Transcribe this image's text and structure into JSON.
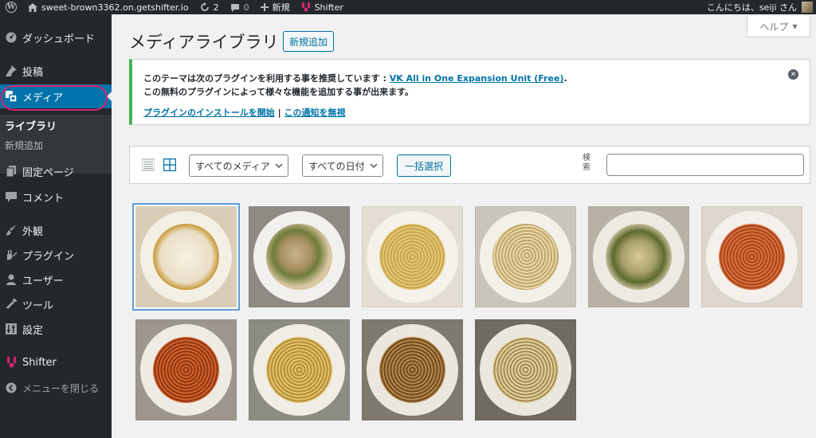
{
  "adminbar": {
    "site_name": "sweet-brown3362.on.getshifter.io",
    "updates_count": "2",
    "comments_count": "0",
    "new_label": "新規",
    "shifter_label": "Shifter",
    "greeting": "こんにちは、seiji さん"
  },
  "sidebar": {
    "dashboard": "ダッシュボード",
    "posts": "投稿",
    "media": "メディア",
    "library": "ライブラリ",
    "add_new": "新規追加",
    "pages": "固定ページ",
    "comments": "コメント",
    "appearance": "外観",
    "plugins": "プラグイン",
    "users": "ユーザー",
    "tools": "ツール",
    "settings": "設定",
    "shifter": "Shifter",
    "collapse": "メニューを閉じる"
  },
  "page": {
    "title": "メディアライブラリ",
    "add_new_button": "新規追加",
    "help_tab": "ヘルプ"
  },
  "notice": {
    "text_before_link": "このテーマは次のプラグインを利用する事を推奨しています : ",
    "plugin_link": "VK All in One Expansion Unit (Free)",
    "text_after_link": ".",
    "line2": "この無料のプラグインによって様々な機能を追加する事が出来ます。",
    "install_link": "プラグインのインストールを開始",
    "separator": " | ",
    "dismiss_link": "この通知を無視"
  },
  "toolbar": {
    "filter_type": "すべてのメディア",
    "filter_date": "すべての日付",
    "bulk_select": "一括選択",
    "search_label": "検索"
  },
  "colors": {
    "admin_dark": "#23282d",
    "accent_blue": "#0073aa",
    "notice_green": "#46b450",
    "highlight_pink": "#d4246c"
  },
  "media_items": [
    {
      "subject": "cream soup dish",
      "selected": true
    },
    {
      "subject": "rigatoni pasta"
    },
    {
      "subject": "plain spaghetti"
    },
    {
      "subject": "tagliatelle with cheese"
    },
    {
      "subject": "rigatoni with herbs"
    },
    {
      "subject": "tomato spaghetti"
    },
    {
      "subject": "tomato spaghetti with olives"
    },
    {
      "subject": "spaghetti with basil"
    },
    {
      "subject": "spaghetti bolognese"
    },
    {
      "subject": "spaghetti aglio e olio"
    }
  ]
}
